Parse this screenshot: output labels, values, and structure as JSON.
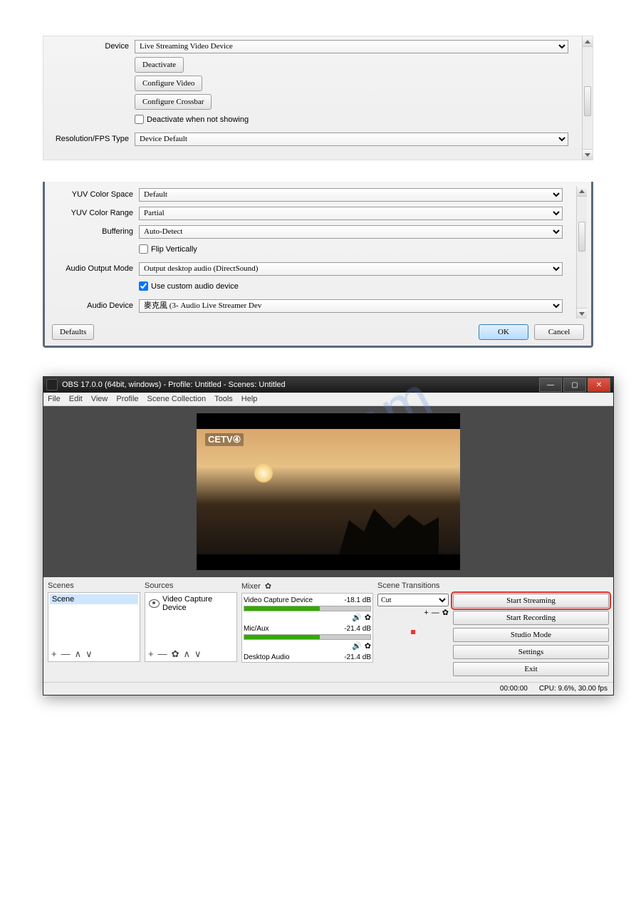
{
  "watermark": "hive.com",
  "panel1": {
    "device_label": "Device",
    "device_value": "Live Streaming Video Device",
    "deactivate": "Deactivate",
    "configure_video": "Configure Video",
    "configure_crossbar": "Configure Crossbar",
    "deactivate_not_showing": "Deactivate when not showing",
    "res_label": "Resolution/FPS Type",
    "res_value": "Device Default"
  },
  "panel2": {
    "yuv_space_label": "YUV Color Space",
    "yuv_space_value": "Default",
    "yuv_range_label": "YUV Color Range",
    "yuv_range_value": "Partial",
    "buffering_label": "Buffering",
    "buffering_value": "Auto-Detect",
    "flip_vert": "Flip Vertically",
    "audio_mode_label": "Audio Output Mode",
    "audio_mode_value": "Output desktop audio (DirectSound)",
    "use_custom_audio": "Use custom audio device",
    "audio_device_label": "Audio Device",
    "audio_device_value": "麥克風 (3- Audio Live Streamer Dev",
    "defaults": "Defaults",
    "ok": "OK",
    "cancel": "Cancel"
  },
  "obs": {
    "title": "OBS 17.0.0 (64bit, windows) - Profile: Untitled - Scenes: Untitled",
    "menu": {
      "file": "File",
      "edit": "Edit",
      "view": "View",
      "profile": "Profile",
      "scene_collection": "Scene Collection",
      "tools": "Tools",
      "help": "Help"
    },
    "preview_logo": "CETV④",
    "scenes_title": "Scenes",
    "scene_item": "Scene",
    "sources_title": "Sources",
    "source_item": "Video Capture Device",
    "mixer_title": "Mixer",
    "mixer_ch1_name": "Video Capture Device",
    "mixer_ch1_db": "-18.1 dB",
    "mixer_ch2_name": "Mic/Aux",
    "mixer_ch2_db": "-21.4 dB",
    "mixer_ch3_name": "Desktop Audio",
    "mixer_ch3_db": "-21.4 dB",
    "transitions_title": "Scene Transitions",
    "transition_value": "Cut",
    "controls": {
      "start_streaming": "Start Streaming",
      "start_recording": "Start Recording",
      "studio_mode": "Studio Mode",
      "settings": "Settings",
      "exit": "Exit"
    },
    "status_time": "00:00:00",
    "status_cpu": "CPU: 9.6%, 30.00 fps"
  }
}
